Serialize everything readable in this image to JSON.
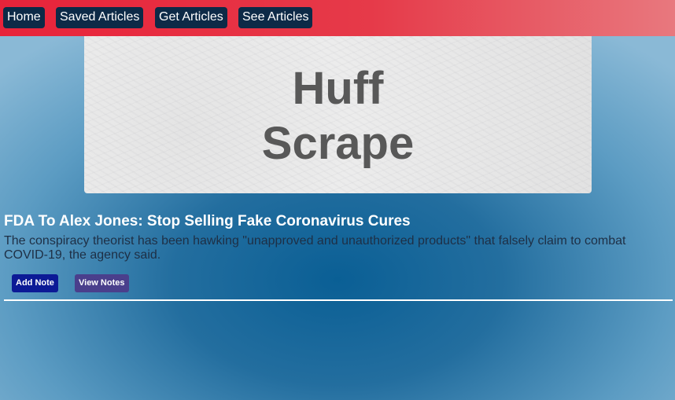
{
  "nav": {
    "items": [
      {
        "label": "Home"
      },
      {
        "label": "Saved Articles"
      },
      {
        "label": "Get Articles"
      },
      {
        "label": "See Articles"
      }
    ]
  },
  "hero": {
    "line1": "Huff",
    "line2": "Scrape"
  },
  "article": {
    "title": "FDA To Alex Jones: Stop Selling Fake Coronavirus Cures",
    "summary": "The conspiracy theorist has been hawking \"unapproved and unauthorized products\" that falsely claim to combat COVID-19, the agency said.",
    "add_note_label": "Add Note",
    "view_notes_label": "View Notes"
  },
  "colors": {
    "navbar": "#e8233a",
    "nav_button": "#0d2a47",
    "add_note_button": "#0c1a96",
    "view_notes_button": "#4a3f8c",
    "background": "#0a5f95"
  }
}
